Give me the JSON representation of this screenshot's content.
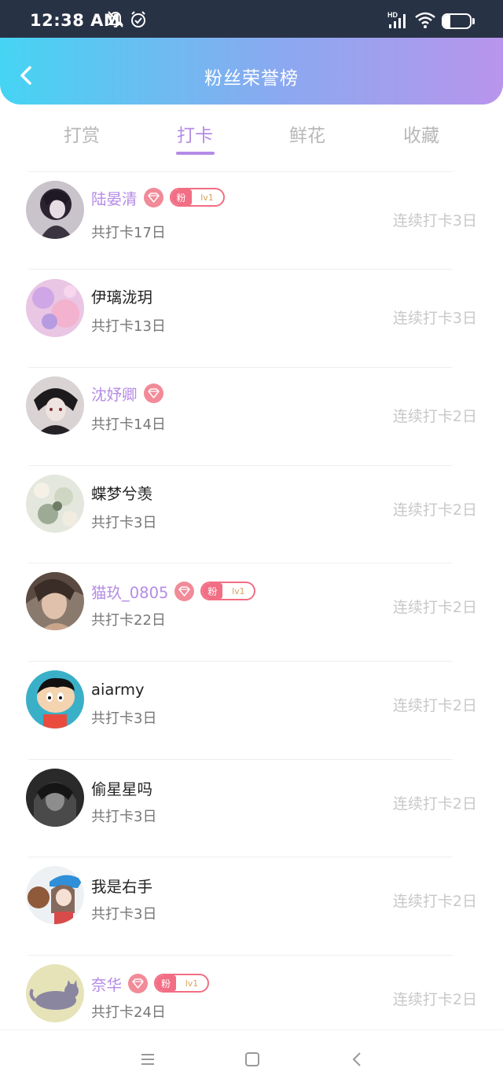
{
  "status_bar": {
    "time": "12:38 AM",
    "battery": "27",
    "network": "HD"
  },
  "header": {
    "title": "粉丝荣誉榜"
  },
  "tabs": [
    {
      "label": "打赏",
      "active": false
    },
    {
      "label": "打卡",
      "active": true
    },
    {
      "label": "鲜花",
      "active": false
    },
    {
      "label": "收藏",
      "active": false
    }
  ],
  "badge": {
    "fan_label": "粉",
    "fan_level": "lv1"
  },
  "fans": [
    {
      "name": "陆晏清",
      "total": "共打卡17日",
      "streak": "连续打卡3日",
      "vip": true,
      "fan_badge": true
    },
    {
      "name": "伊璃泷玥",
      "total": "共打卡13日",
      "streak": "连续打卡3日",
      "vip": false,
      "fan_badge": false
    },
    {
      "name": "沈妤卿",
      "total": "共打卡14日",
      "streak": "连续打卡2日",
      "vip": true,
      "fan_badge": false
    },
    {
      "name": "蝶梦兮羡",
      "total": "共打卡3日",
      "streak": "连续打卡2日",
      "vip": false,
      "fan_badge": false
    },
    {
      "name": "猫玖_0805",
      "total": "共打卡22日",
      "streak": "连续打卡2日",
      "vip": true,
      "fan_badge": true
    },
    {
      "name": "aiarmy",
      "total": "共打卡3日",
      "streak": "连续打卡2日",
      "vip": false,
      "fan_badge": false
    },
    {
      "name": "偷星星吗",
      "total": "共打卡3日",
      "streak": "连续打卡2日",
      "vip": false,
      "fan_badge": false
    },
    {
      "name": "我是右手",
      "total": "共打卡3日",
      "streak": "连续打卡2日",
      "vip": false,
      "fan_badge": false
    },
    {
      "name": "奈华",
      "total": "共打卡24日",
      "streak": "连续打卡2日",
      "vip": true,
      "fan_badge": true
    }
  ],
  "colors": {
    "accent": "#b58be6",
    "header_gradient_start": "#45d4f3",
    "header_gradient_end": "#b895ec",
    "badge_pink": "#f28a98",
    "fan_badge_red": "#f26e84",
    "muted_text": "#c8c8c8"
  },
  "icons": {
    "back": "chevron-left-icon",
    "mute": "bell-off-icon",
    "alarm": "alarm-clock-icon",
    "signal": "signal-icon",
    "wifi": "wifi-icon",
    "battery": "battery-icon",
    "vip": "diamond-icon",
    "nav_menu": "menu-icon",
    "nav_home": "square-icon",
    "nav_back": "chevron-left-icon"
  }
}
